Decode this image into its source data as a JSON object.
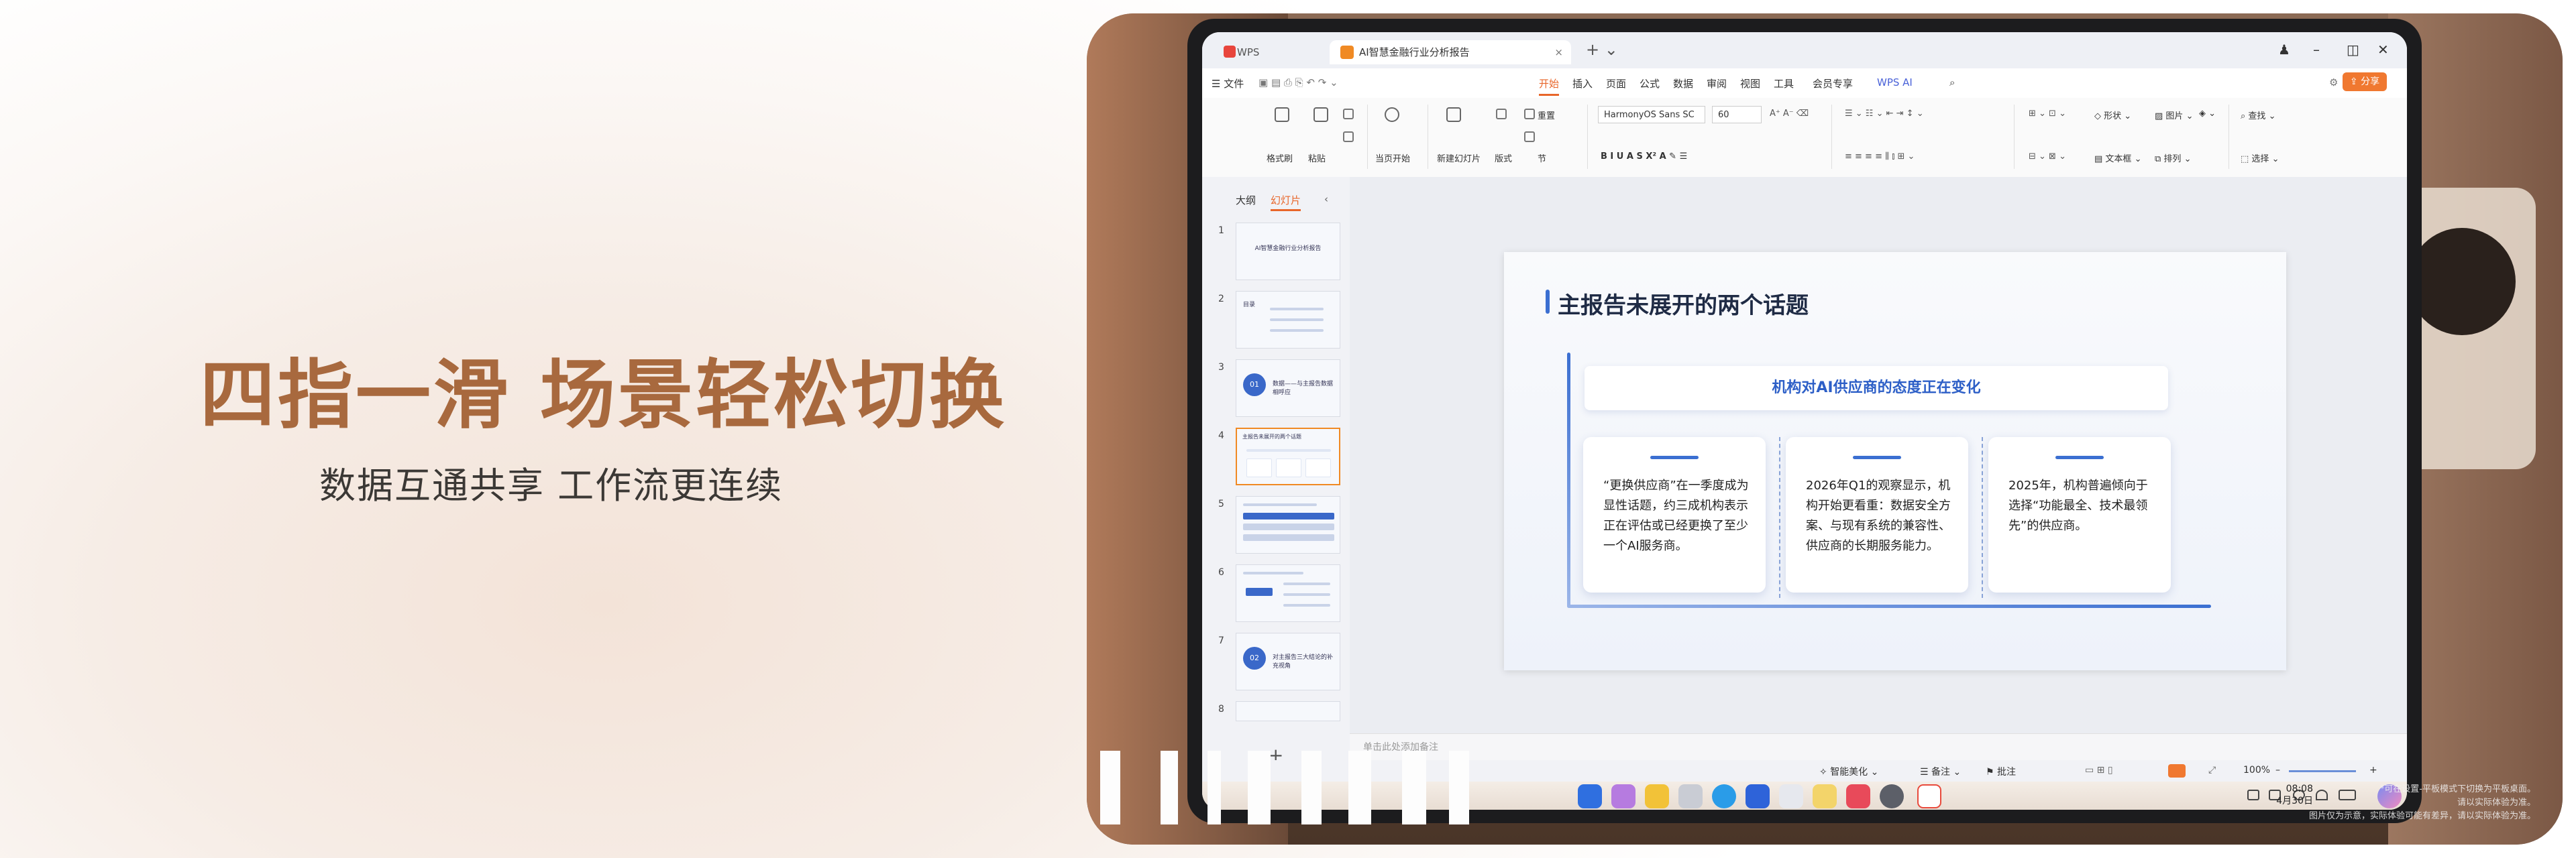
{
  "hero": {
    "headline": "四指一滑 场景轻松切换",
    "subline": "数据互通共享 工作流更连续"
  },
  "wps": {
    "tabs": {
      "app": "WPS Office",
      "doc": "AI智慧金融行业分析报告"
    },
    "menu": {
      "file": "文件",
      "items": [
        "开始",
        "插入",
        "页面",
        "公式",
        "数据",
        "审阅",
        "视图",
        "工具",
        "会员专享",
        "WPS AI"
      ],
      "active": "开始",
      "share": "分享"
    },
    "ribbon": {
      "format_painter": "格式刷",
      "paste": "粘贴",
      "play_from_current": "当页开始",
      "new_slide": "新建幻灯片",
      "layout": "版式",
      "section": "节",
      "reset": "重置",
      "font": "HarmonyOS Sans SC",
      "font_size": "60",
      "shape": "形状",
      "picture": "图片",
      "find": "查找",
      "textbox": "文本框",
      "arrange": "排列",
      "select": "选择"
    },
    "pane": {
      "tab_outline": "大纲",
      "tab_slides": "幻灯片",
      "thumbs": [
        {
          "num": "1",
          "text": "AI智慧金融行业分析报告"
        },
        {
          "num": "2",
          "text": "目录"
        },
        {
          "num": "3",
          "text": "数据——与主报告数据相呼应",
          "badge": "01"
        },
        {
          "num": "4",
          "text": "主报告未展开的两个话题"
        },
        {
          "num": "5",
          "text": ""
        },
        {
          "num": "6",
          "text": ""
        },
        {
          "num": "7",
          "text": "对主报告三大结论的补充视角",
          "badge": "02"
        },
        {
          "num": "8",
          "text": ""
        }
      ],
      "add": "+"
    },
    "slide": {
      "title": "主报告未展开的两个话题",
      "banner": "机构对AI供应商的态度正在变化",
      "cards": [
        "“更换供应商”在一季度成为显性话题，约三成机构表示正在评估或已经更换了至少一个AI服务商。",
        "2026年Q1的观察显示，机构开始更看重：数据安全方案、与现有系统的兼容性、供应商的长期服务能力。",
        "2025年，机构普遍倾向于选择“功能最全、技术最领先”的供应商。"
      ]
    },
    "notes_placeholder": "单击此处添加备注",
    "status": {
      "beautify": "智能美化",
      "notes": "备注",
      "comments": "批注",
      "zoom": "100%"
    }
  },
  "dock": {
    "time": "08:08",
    "date": "4月30日"
  },
  "disclaimer": [
    "*可在设置-平板模式下切换为平板桌面。",
    "请以实际体验为准。",
    "图片仅为示意，实际体验可能有差异，请以实际体验为准。"
  ],
  "colors": {
    "headline": "#a8693e",
    "accent_orange": "#f07830",
    "accent_blue": "#3b6fd1"
  }
}
